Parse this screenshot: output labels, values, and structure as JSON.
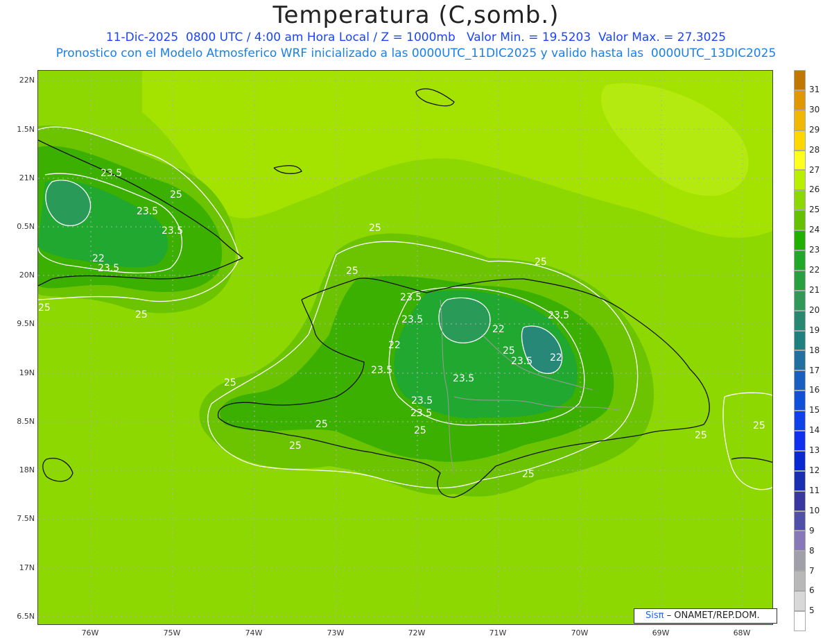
{
  "title": "Temperatura (C,somb.)",
  "subtitle1": "11-Dic-2025  0800 UTC / 4:00 am Hora Local / Z = 1000mb   Valor Min. = 19.5203  Valor Max. = 27.3025",
  "subtitle2": "Pronostico con el Modelo Atmosferico WRF inicializado a las 0000UTC_11DIC2025 y valido hasta las  0000UTC_13DIC2025",
  "lat_labels": [
    "22N",
    "1.5N",
    "21N",
    "0.5N",
    "20N",
    "9.5N",
    "19N",
    "8.5N",
    "18N",
    "7.5N",
    "17N",
    "6.5N"
  ],
  "lon_labels": [
    "76W",
    "75W",
    "74W",
    "73W",
    "72W",
    "71W",
    "70W",
    "69W",
    "68W"
  ],
  "contour_labels": [
    "23.5",
    "25",
    "23.5",
    "23.5",
    "22",
    "23.5",
    "25",
    "25",
    "25",
    "25",
    "25",
    "23.5",
    "23.5",
    "22",
    "22",
    "25",
    "23.5",
    "23.5",
    "22",
    "23.5",
    "23.5",
    "23.5",
    "25",
    "25",
    "25",
    "23.5",
    "25",
    "25",
    "25",
    "25"
  ],
  "colorbar": {
    "labels": [
      "31",
      "30",
      "29",
      "28",
      "27",
      "26",
      "25",
      "24",
      "23",
      "22",
      "21",
      "20",
      "19",
      "18",
      "17",
      "16",
      "15",
      "14",
      "13",
      "12",
      "11",
      "10",
      "9",
      "8",
      "7",
      "6",
      "5"
    ],
    "colors": [
      "#c07800",
      "#e09800",
      "#f0b800",
      "#ffd800",
      "#ffff20",
      "#b8f000",
      "#8cd800",
      "#64c000",
      "#20b000",
      "#20a828",
      "#28a040",
      "#309858",
      "#288870",
      "#208080",
      "#2070a0",
      "#1860c0",
      "#1050d8",
      "#1040e8",
      "#1030f0",
      "#0828d0",
      "#1830b0",
      "#3838a0",
      "#5050a8",
      "#8878b8",
      "#a0a0a8",
      "#b8b8b8",
      "#d8d8d8",
      "#ffffff"
    ]
  },
  "credit": {
    "sis": "Sisπ",
    "text": "– ONAMET/REP.DOM."
  }
}
